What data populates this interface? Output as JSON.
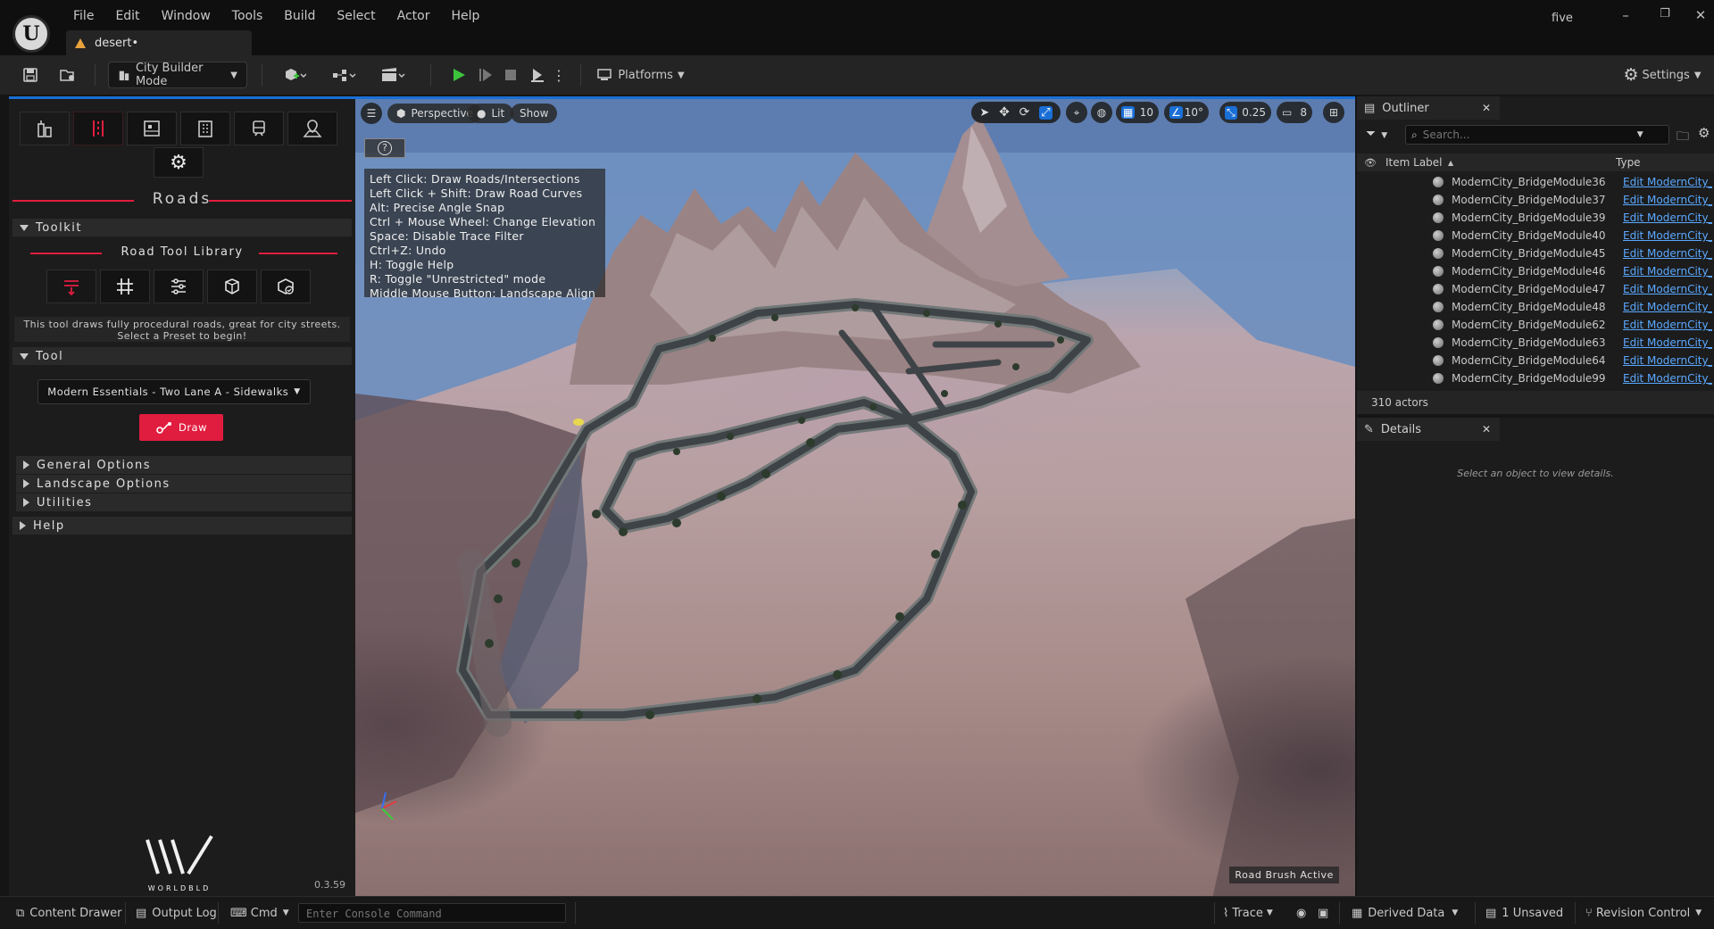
{
  "app": {
    "project": "five",
    "document_tab": "desert•",
    "window_controls": [
      "–",
      "❐",
      "✕"
    ]
  },
  "menu": [
    "File",
    "Edit",
    "Window",
    "Tools",
    "Build",
    "Select",
    "Actor",
    "Help"
  ],
  "toolbar": {
    "mode_label": "City Builder Mode",
    "platforms_label": "Platforms",
    "settings_label": "Settings"
  },
  "left_panel": {
    "section_title": "Roads",
    "toolkit_label": "Toolkit",
    "library_label": "Road Tool Library",
    "tool_description": "This tool draws fully procedural roads, great for city streets. Select a Preset to begin!",
    "tool_label": "Tool",
    "preset_value": "Modern Essentials - Two Lane A - Sidewalks",
    "draw_label": "Draw",
    "general_options": "General Options",
    "landscape_options": "Landscape Options",
    "utilities": "Utilities",
    "help": "Help",
    "brand": "WORLDBLD",
    "version": "0.3.59"
  },
  "viewport": {
    "perspective": "Perspective",
    "lit": "Lit",
    "show": "Show",
    "grid_snap": "10",
    "angle_snap": "10°",
    "scale_snap": "0.25",
    "camera_speed": "8",
    "help_lines": [
      "Left Click: Draw Roads/Intersections",
      "Left Click + Shift: Draw Road Curves",
      "Alt: Precise Angle Snap",
      "Ctrl + Mouse Wheel: Change Elevation",
      "Space: Disable Trace Filter",
      "Ctrl+Z: Undo",
      "H: Toggle Help",
      "R: Toggle \"Unrestricted\" mode",
      "Middle Mouse Button:  Landscape Align"
    ],
    "status": "Road Brush Active"
  },
  "outliner": {
    "tab": "Outliner",
    "search_placeholder": "Search...",
    "col_label": "Item Label",
    "col_type": "Type",
    "rows": [
      {
        "label": "ModernCity_BridgeModule36",
        "type": "Edit ModernCity_"
      },
      {
        "label": "ModernCity_BridgeModule37",
        "type": "Edit ModernCity_"
      },
      {
        "label": "ModernCity_BridgeModule39",
        "type": "Edit ModernCity_"
      },
      {
        "label": "ModernCity_BridgeModule40",
        "type": "Edit ModernCity_"
      },
      {
        "label": "ModernCity_BridgeModule45",
        "type": "Edit ModernCity_"
      },
      {
        "label": "ModernCity_BridgeModule46",
        "type": "Edit ModernCity_"
      },
      {
        "label": "ModernCity_BridgeModule47",
        "type": "Edit ModernCity_"
      },
      {
        "label": "ModernCity_BridgeModule48",
        "type": "Edit ModernCity_"
      },
      {
        "label": "ModernCity_BridgeModule62",
        "type": "Edit ModernCity_"
      },
      {
        "label": "ModernCity_BridgeModule63",
        "type": "Edit ModernCity_"
      },
      {
        "label": "ModernCity_BridgeModule64",
        "type": "Edit ModernCity_"
      },
      {
        "label": "ModernCity_BridgeModule99",
        "type": "Edit ModernCity_"
      }
    ],
    "actor_count": "310 actors"
  },
  "details": {
    "tab": "Details",
    "empty": "Select an object to view details."
  },
  "statusbar": {
    "content_drawer": "Content Drawer",
    "output_log": "Output Log",
    "cmd": "Cmd",
    "console_placeholder": "Enter Console Command",
    "trace": "Trace",
    "derived_data": "Derived Data",
    "unsaved": "1 Unsaved",
    "revision_control": "Revision Control"
  },
  "colors": {
    "accent_red": "#e11d3f",
    "selection_blue": "#1a6fd6",
    "play_green": "#3cc43c",
    "link_blue": "#5aa8ff"
  }
}
